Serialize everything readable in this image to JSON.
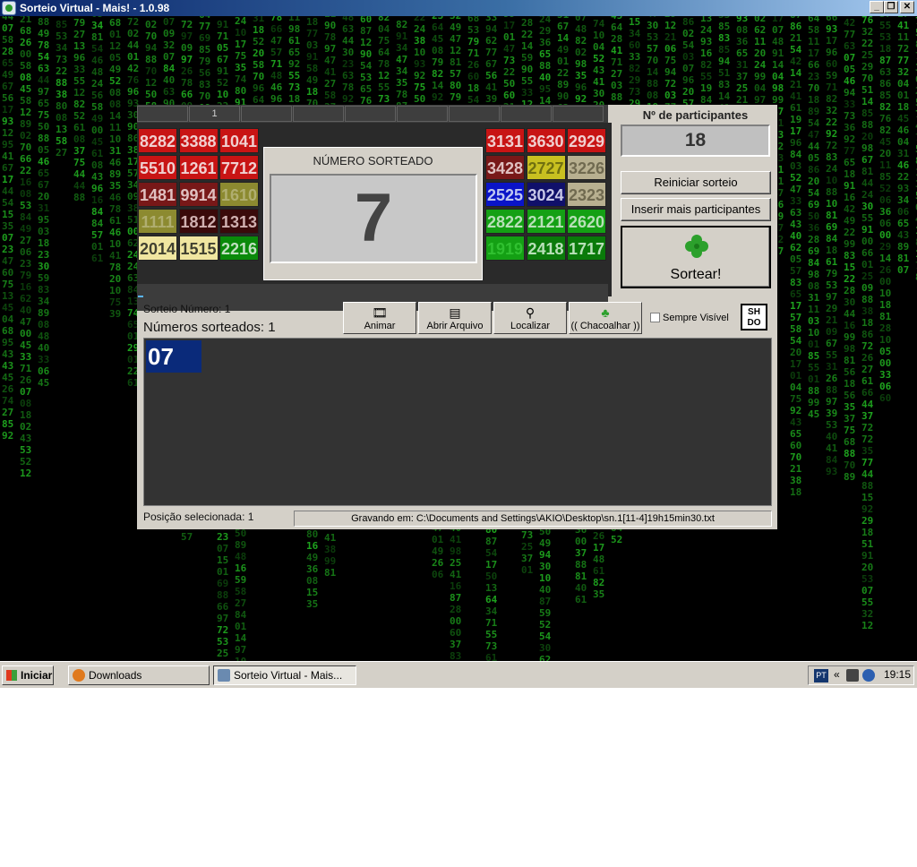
{
  "window": {
    "title": "Sorteio Virtual - Mais! - 1.0.98",
    "minimize": "_",
    "maximize": "❐",
    "close": "✕"
  },
  "tabs": [
    "",
    "1",
    "",
    "",
    "",
    "",
    "",
    "",
    ""
  ],
  "left_grid": [
    {
      "n": "8282",
      "bg": "#c81414",
      "fg": "#f0d0d0"
    },
    {
      "n": "3388",
      "bg": "#c81414",
      "fg": "#f0d0d0"
    },
    {
      "n": "1041",
      "bg": "#c81414",
      "fg": "#f0d0d0"
    },
    {
      "n": "5510",
      "bg": "#c81414",
      "fg": "#f0d0d0"
    },
    {
      "n": "1261",
      "bg": "#c81414",
      "fg": "#f0d0d0"
    },
    {
      "n": "7712",
      "bg": "#c81414",
      "fg": "#f0d0d0"
    },
    {
      "n": "1481",
      "bg": "#781818",
      "fg": "#e0c0c0"
    },
    {
      "n": "9914",
      "bg": "#781818",
      "fg": "#e0c0c0"
    },
    {
      "n": "1610",
      "bg": "#8c8a30",
      "fg": "#b0ae70"
    },
    {
      "n": "1111",
      "bg": "#8c8a30",
      "fg": "#b0ae70"
    },
    {
      "n": "1812",
      "bg": "#3a0a0a",
      "fg": "#d0b0b0"
    },
    {
      "n": "1313",
      "bg": "#3a0a0a",
      "fg": "#d0b0b0"
    },
    {
      "n": "2014",
      "bg": "#f0e6a0",
      "fg": "#404030"
    },
    {
      "n": "1515",
      "bg": "#f0e6a0",
      "fg": "#404030"
    },
    {
      "n": "2216",
      "bg": "#0a8a0a",
      "fg": "#c0e0c0"
    }
  ],
  "right_grid": [
    {
      "n": "3131",
      "bg": "#c81414",
      "fg": "#f0d0d0"
    },
    {
      "n": "3630",
      "bg": "#c81414",
      "fg": "#f0d0d0"
    },
    {
      "n": "2929",
      "bg": "#c81414",
      "fg": "#f0d0d0"
    },
    {
      "n": "3428",
      "bg": "#781818",
      "fg": "#e0c0c0"
    },
    {
      "n": "2727",
      "bg": "#c8c020",
      "fg": "#707010"
    },
    {
      "n": "3226",
      "bg": "#b8b090",
      "fg": "#706a50"
    },
    {
      "n": "2525",
      "bg": "#0a14c8",
      "fg": "#c0c8f0"
    },
    {
      "n": "3024",
      "bg": "#10106a",
      "fg": "#c8c8e8"
    },
    {
      "n": "2323",
      "bg": "#b8b090",
      "fg": "#706a50"
    },
    {
      "n": "2822",
      "bg": "#14a014",
      "fg": "#b8e0b8"
    },
    {
      "n": "2121",
      "bg": "#14a014",
      "fg": "#b8e0b8"
    },
    {
      "n": "2620",
      "bg": "#14a014",
      "fg": "#b8e0b8"
    },
    {
      "n": "1919",
      "bg": "#14a014",
      "fg": "#30c030"
    },
    {
      "n": "2418",
      "bg": "#0a7a0a",
      "fg": "#b8e0b8"
    },
    {
      "n": "1717",
      "bg": "#0a7a0a",
      "fg": "#b8e0b8"
    }
  ],
  "drawn": {
    "label": "NÚMERO SORTEADO",
    "value": "7"
  },
  "participants": {
    "label": "Nº de participantes",
    "value": "18"
  },
  "buttons": {
    "reset": "Reiniciar sorteio",
    "insert": "Inserir mais participantes",
    "draw": "Sortear!"
  },
  "toolbar": {
    "animate": "Animar",
    "open_file": "Abrir Arquivo",
    "locate": "Localizar",
    "shake": "(( Chacoalhar ))",
    "always_visible": "Sempre Visível",
    "logo": "SH DO"
  },
  "info": {
    "draw_number": "Sorteio Número: 1",
    "drawn_count": "Números sorteados: 1",
    "selected_position": "Posição selecionada: 1",
    "saving": "Gravando em: C:\\Documents and Settings\\AKIO\\Desktop\\sn.1[11-4]19h15min30.txt"
  },
  "results": [
    "07"
  ],
  "taskbar": {
    "start": "Iniciar",
    "items": [
      "Downloads",
      "Sorteio Virtual - Mais..."
    ],
    "lang": "PT",
    "chevron": "«",
    "clock": "19:15"
  },
  "colors": {
    "matrix_green": "#1fa51f",
    "panel_gray": "#d4d0c8",
    "result_chip": "#0a2a7a"
  }
}
